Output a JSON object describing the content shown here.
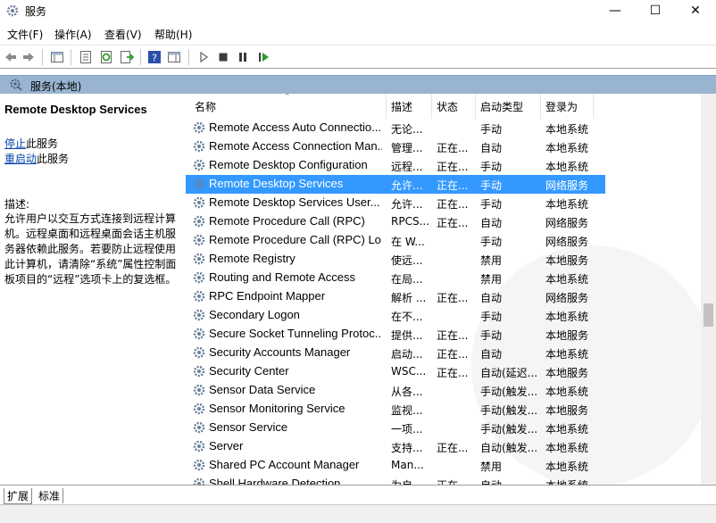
{
  "window": {
    "title": "服务",
    "controls": {
      "minimize": "—",
      "maximize": "☐",
      "close": "✕"
    }
  },
  "menu": [
    "文件(F)",
    "操作(A)",
    "查看(V)",
    "帮助(H)"
  ],
  "toolbar": {
    "icons": [
      "back-arrow-icon",
      "forward-arrow-icon",
      "console-tree-icon",
      "properties-icon",
      "refresh-icon",
      "export-list-icon",
      "help-icon",
      "show-hide-icon",
      "play-icon",
      "stop-icon",
      "pause-icon",
      "restart-icon"
    ]
  },
  "pane_header": {
    "title": "服务(本地)"
  },
  "details": {
    "service_name": "Remote Desktop Services",
    "stop_link": "停止",
    "stop_suffix": "此服务",
    "restart_link": "重启动",
    "restart_suffix": "此服务",
    "desc_label": "描述:",
    "description": "允许用户以交互方式连接到远程计算机。远程桌面和远程桌面会话主机服务器依赖此服务。若要防止远程使用此计算机，请清除“系统”属性控制面板项目的“远程”选项卡上的复选框。"
  },
  "columns": {
    "name": "名称",
    "desc": "描述",
    "status": "状态",
    "start": "启动类型",
    "logon": "登录为"
  },
  "rows": [
    {
      "name": "Remote Access Auto Connectio...",
      "desc": "无论...",
      "status": "",
      "start": "手动",
      "logon": "本地系统"
    },
    {
      "name": "Remote Access Connection Man...",
      "desc": "管理...",
      "status": "正在...",
      "start": "自动",
      "logon": "本地系统"
    },
    {
      "name": "Remote Desktop Configuration",
      "desc": "远程...",
      "status": "正在...",
      "start": "手动",
      "logon": "本地系统"
    },
    {
      "name": "Remote Desktop Services",
      "desc": "允许...",
      "status": "正在...",
      "start": "手动",
      "logon": "网络服务"
    },
    {
      "name": "Remote Desktop Services User...",
      "desc": "允许...",
      "status": "正在...",
      "start": "手动",
      "logon": "本地系统"
    },
    {
      "name": "Remote Procedure Call (RPC)",
      "desc": "RPCS...",
      "status": "正在...",
      "start": "自动",
      "logon": "网络服务"
    },
    {
      "name": "Remote Procedure Call (RPC) Lo...",
      "desc": "在 W...",
      "status": "",
      "start": "手动",
      "logon": "网络服务"
    },
    {
      "name": "Remote Registry",
      "desc": "使远...",
      "status": "",
      "start": "禁用",
      "logon": "本地服务"
    },
    {
      "name": "Routing and Remote Access",
      "desc": "在局...",
      "status": "",
      "start": "禁用",
      "logon": "本地系统"
    },
    {
      "name": "RPC Endpoint Mapper",
      "desc": "解析 ...",
      "status": "正在...",
      "start": "自动",
      "logon": "网络服务"
    },
    {
      "name": "Secondary Logon",
      "desc": "在不...",
      "status": "",
      "start": "手动",
      "logon": "本地系统"
    },
    {
      "name": "Secure Socket Tunneling Protoc...",
      "desc": "提供...",
      "status": "正在...",
      "start": "手动",
      "logon": "本地服务"
    },
    {
      "name": "Security Accounts Manager",
      "desc": "启动...",
      "status": "正在...",
      "start": "自动",
      "logon": "本地系统"
    },
    {
      "name": "Security Center",
      "desc": "WSC...",
      "status": "正在...",
      "start": "自动(延迟...",
      "logon": "本地服务"
    },
    {
      "name": "Sensor Data Service",
      "desc": "从各...",
      "status": "",
      "start": "手动(触发...",
      "logon": "本地系统"
    },
    {
      "name": "Sensor Monitoring Service",
      "desc": "监视...",
      "status": "",
      "start": "手动(触发...",
      "logon": "本地服务"
    },
    {
      "name": "Sensor Service",
      "desc": "一项...",
      "status": "",
      "start": "手动(触发...",
      "logon": "本地系统"
    },
    {
      "name": "Server",
      "desc": "支持...",
      "status": "正在...",
      "start": "自动(触发...",
      "logon": "本地系统"
    },
    {
      "name": "Shared PC Account Manager",
      "desc": "Man...",
      "status": "",
      "start": "禁用",
      "logon": "本地系统"
    },
    {
      "name": "Shell Hardware Detection",
      "desc": "为自...",
      "status": "正在...",
      "start": "自动",
      "logon": "本地系统"
    }
  ],
  "selected_row": "Remote Desktop Services",
  "tabs": {
    "extended": "扩展",
    "standard": "标准"
  },
  "colors": {
    "selection": "#3399ff",
    "pane_header": "#99b4d1",
    "link": "#0645ad"
  }
}
